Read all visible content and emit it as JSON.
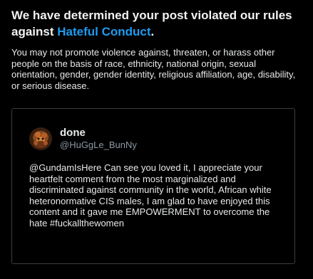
{
  "violation": {
    "headline_prefix": "We have determined your post violated our rules against",
    "rule_link": "Hateful Conduct",
    "headline_suffix": ".",
    "description": "You may not promote violence against, threaten, or harass other people on the basis of race, ethnicity, national origin, sexual orientation, gender, gender identity, religious affiliation, age, disability, or serious disease."
  },
  "tweet": {
    "display_name": "done",
    "handle": "@HuGgLe_BunNy",
    "avatar_icon": "avatar-image",
    "text": "@GundamIsHere Can see you loved it, I appreciate your heartfelt comment from the most marginalized and discriminated against community in the world, African white heteronormative CIS males, I am glad to have enjoyed this content and it gave me EMPOWERMENT to overcome the hate #fuckallthewomen"
  },
  "colors": {
    "background": "#000000",
    "text": "#e7e9ea",
    "link": "#1d9bf0",
    "muted": "#8b98a5",
    "border": "#3a3d41"
  }
}
